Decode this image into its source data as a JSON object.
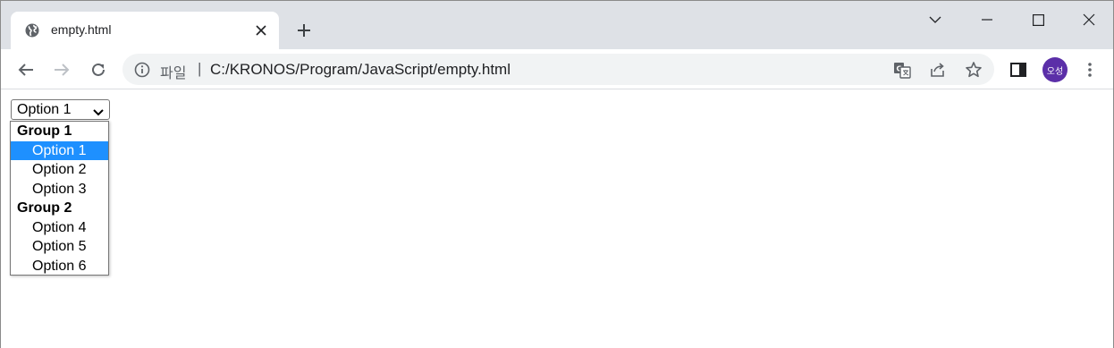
{
  "tab": {
    "title": "empty.html",
    "favicon": "globe-icon"
  },
  "window_controls": [
    "chevron-down-icon",
    "minimize-icon",
    "maximize-icon",
    "close-icon"
  ],
  "omnibox": {
    "scheme_label": "파일",
    "separator": "|",
    "url": "C:/KRONOS/Program/JavaScript/empty.html",
    "icons": [
      "info-icon",
      "translate-icon",
      "share-icon",
      "star-icon"
    ]
  },
  "profile": {
    "avatar_text": "오성",
    "avatar_color": "#5b2fa8"
  },
  "select": {
    "value": "Option 1",
    "groups": [
      {
        "label": "Group 1",
        "options": [
          "Option 1",
          "Option 2",
          "Option 3"
        ]
      },
      {
        "label": "Group 2",
        "options": [
          "Option 4",
          "Option 5",
          "Option 6"
        ]
      }
    ],
    "highlighted": "Option 1",
    "highlight_color": "#1e90ff"
  }
}
